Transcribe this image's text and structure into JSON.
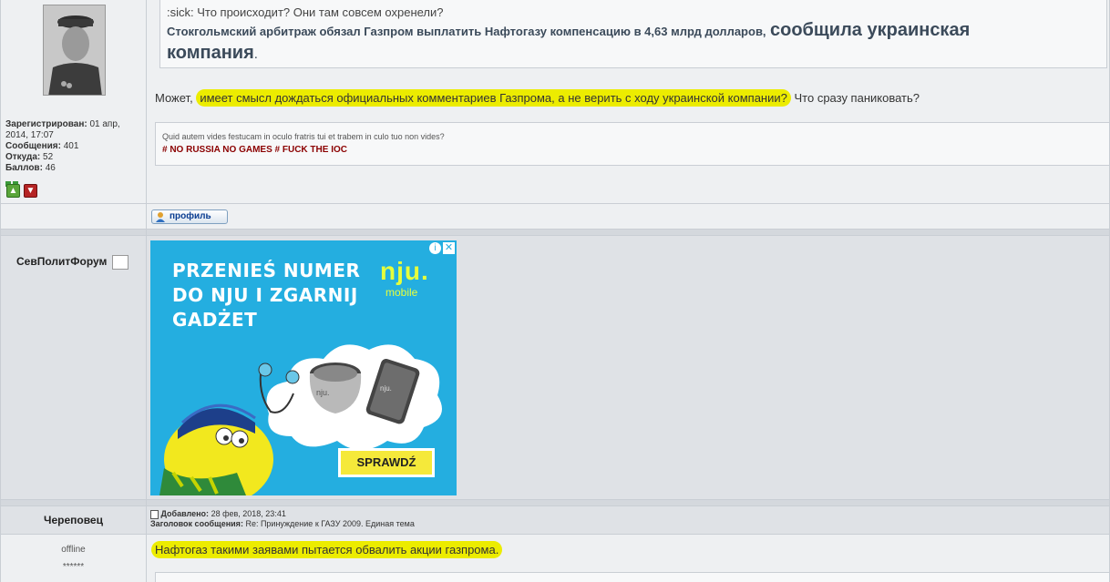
{
  "post1": {
    "registered_label": "Зарегистрирован:",
    "registered_value": "01 апр, 2014, 17:07",
    "messages_label": "Сообщения:",
    "messages_value": "401",
    "from_label": "Откуда:",
    "from_value": "52",
    "points_label": "Баллов:",
    "points_value": "46",
    "quote_line1": ":sick: Что происходит? Они там совсем охренели?",
    "quote_line2_a": "Стокгольмский арбитраж обязал Газпром выплатить Нафтогазу компенсацию в 4,63 млрд долларов,",
    "quote_line2_b": "сообщила украинская",
    "quote_line3": "компания",
    "quote_line3_end": ".",
    "body_prefix": "Может,",
    "body_highlight": "имеет смысл дождаться официальных комментариев Газпрома, а не верить с ходу украинской компании?",
    "body_suffix": "Что сразу паниковать?",
    "sig_line1": "Quid autem vides festucam in oculo fratris tui et trabem in culo tuo non vides?",
    "sig_line2": "# NO RUSSIA NO GAMES # FUCK THE IOC",
    "profile_button": "профиль"
  },
  "ad_post": {
    "author": "СевПолитФорум",
    "ad_headline_1": "PRZENIEŚ NUMER",
    "ad_headline_2": "DO NJU I ZGARNIJ",
    "ad_headline_3": "GADŻET",
    "ad_brand": "nju.",
    "ad_brand_sub": "mobile",
    "ad_cta": "SPRAWDŹ",
    "ad_speaker_label": "nju.",
    "ad_phone_label": "nju."
  },
  "post2": {
    "author": "Череповец",
    "status": "offline",
    "stars": "******",
    "added_label": "Добавлено:",
    "added_value": "28 фев, 2018, 23:41",
    "subject_label": "Заголовок сообщения:",
    "subject_value": "Re: Принуждение к ГАЗУ 2009. Единая тема",
    "body_highlight": "Нафтогаз такими заявами пытается обвалить акции газпрома."
  },
  "colors": {
    "highlight": "#ecec00",
    "ad_background": "#24aee0",
    "ad_cta_background": "#f5e93a",
    "signature_red": "#8b0000"
  }
}
